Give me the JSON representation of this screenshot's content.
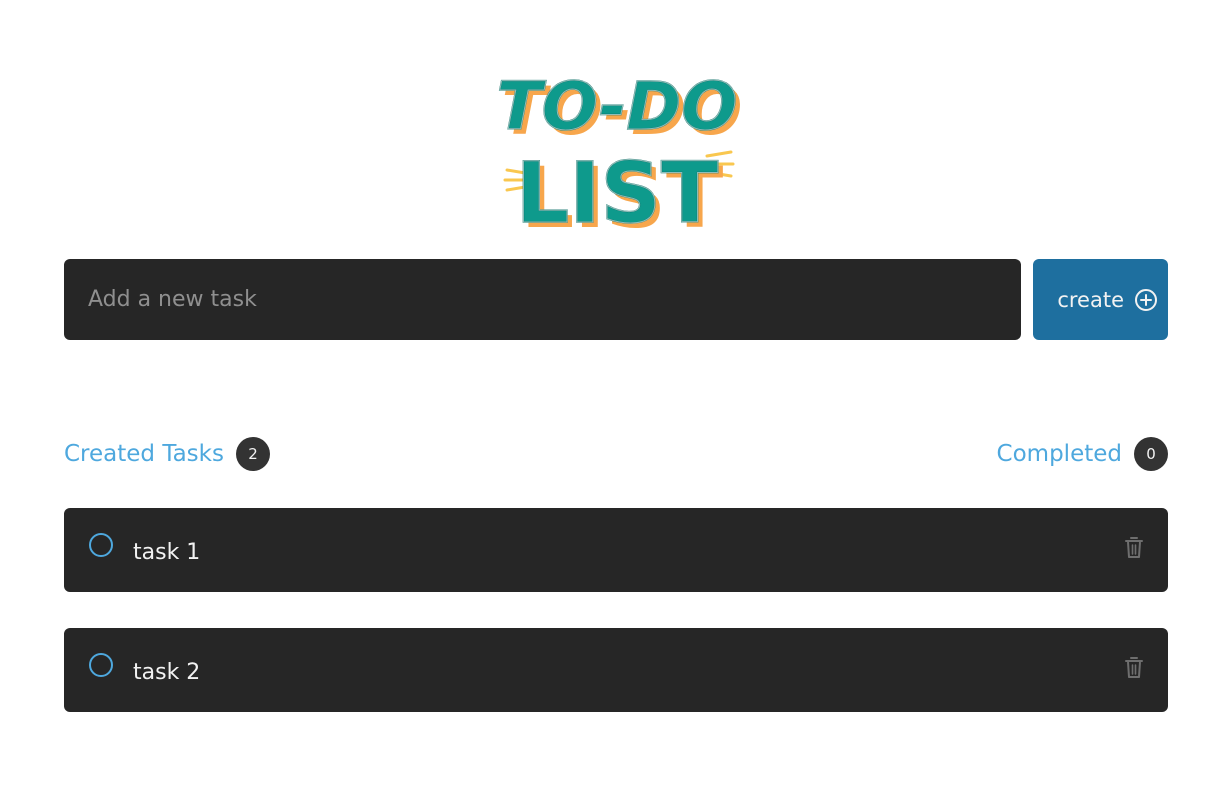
{
  "logo": {
    "line1": "To-Do",
    "line2": "LIST",
    "colors": {
      "primary": "#0e9a8c",
      "shadow": "#f7a64c",
      "accent": "#f9c74f"
    }
  },
  "new_task": {
    "placeholder": "Add a new task",
    "value": ""
  },
  "create_button": {
    "label": "create",
    "icon": "plus-circle-icon"
  },
  "counters": {
    "created": {
      "label": "Created Tasks",
      "count": "2"
    },
    "completed": {
      "label": "Completed",
      "count": "0"
    }
  },
  "tasks": [
    {
      "text": "task 1",
      "completed": false
    },
    {
      "text": "task 2",
      "completed": false
    }
  ],
  "colors": {
    "background": "#ffffff",
    "surface": "#262626",
    "accent_blue": "#4ea8de",
    "button_blue": "#1e6f9f",
    "badge": "#333333",
    "trash": "#808080"
  }
}
